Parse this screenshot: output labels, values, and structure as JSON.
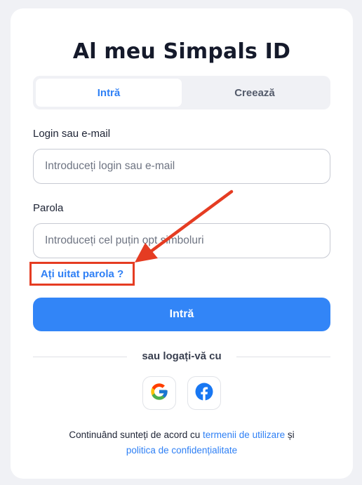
{
  "title": "Al meu Simpals ID",
  "tabs": [
    {
      "label": "Intră",
      "active": true
    },
    {
      "label": "Creează",
      "active": false
    }
  ],
  "login": {
    "label": "Login sau e-mail",
    "placeholder": "Introduceți login sau e-mail",
    "value": ""
  },
  "password": {
    "label": "Parola",
    "placeholder": "Introduceți cel puțin opt simboluri",
    "value": ""
  },
  "forgot_password": "Ați uitat parola ?",
  "submit_label": "Intră",
  "divider_text": "sau logați-vă cu",
  "social": [
    {
      "icon": "google-icon"
    },
    {
      "icon": "facebook-icon"
    }
  ],
  "terms": {
    "prefix": "Continuând sunteți de acord cu",
    "terms_link": "termenii de utilizare",
    "and": "și",
    "privacy_link": "politica de confidențialitate"
  },
  "colors": {
    "accent": "#3285f7",
    "annotation": "#e53c22",
    "facebook": "#1877f2"
  }
}
